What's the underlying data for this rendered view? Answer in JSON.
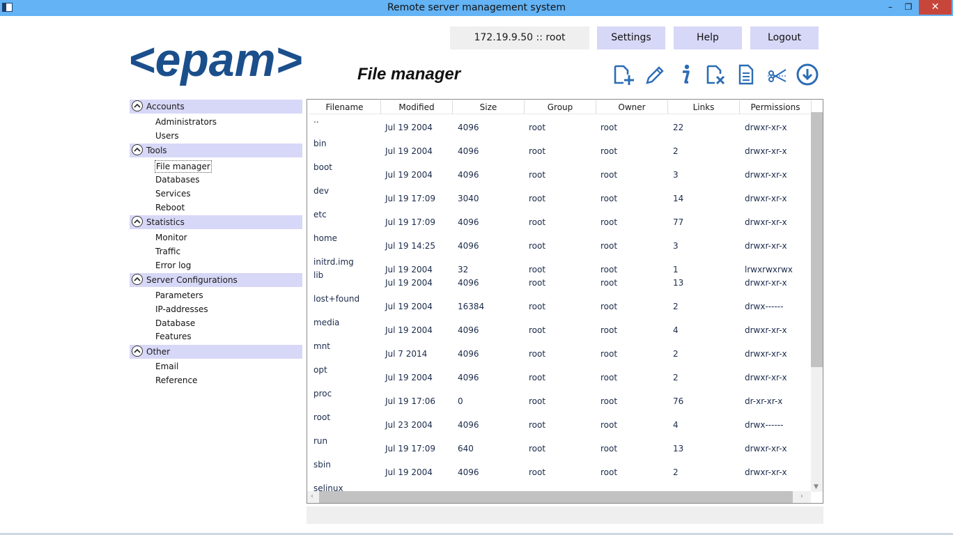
{
  "window": {
    "title": "Remote server management system",
    "minimize": "–",
    "maximize": "❐",
    "close": "✕"
  },
  "header": {
    "user_info": "172.19.9.50 :: root",
    "settings_label": "Settings",
    "help_label": "Help",
    "logout_label": "Logout",
    "page_title": "File manager",
    "logo_text": "<epam>",
    "brand_color": "#1b4f8c"
  },
  "toolbar": {
    "icons": [
      "new-file-icon",
      "edit-pencil-icon",
      "info-icon",
      "delete-file-icon",
      "document-icon",
      "cut-scissors-icon",
      "download-icon"
    ],
    "icon_color": "#2b6cb4"
  },
  "sidebar": {
    "sections": [
      {
        "label": "Accounts",
        "items": [
          "Administrators",
          "Users"
        ]
      },
      {
        "label": "Tools",
        "items": [
          "File manager",
          "Databases",
          "Services",
          "Reboot"
        ]
      },
      {
        "label": "Statistics",
        "items": [
          "Monitor",
          "Traffic",
          "Error log"
        ]
      },
      {
        "label": "Server Configurations",
        "items": [
          "Parameters",
          "IP-addresses",
          "Database",
          "Features"
        ]
      },
      {
        "label": "Other",
        "items": [
          "Email",
          "Reference"
        ]
      }
    ],
    "active_item": "File manager"
  },
  "table": {
    "columns": [
      "Filename",
      "Modified",
      "Size",
      "Group",
      "Owner",
      "Links",
      "Permissions"
    ],
    "rows": [
      {
        "name": "..",
        "modified": "Jul 19 2004",
        "size": "4096",
        "group": "root",
        "owner": "root",
        "links": "22",
        "perms": "drwxr-xr-x"
      },
      {
        "name": "bin",
        "modified": "Jul 19 2004",
        "size": "4096",
        "group": "root",
        "owner": "root",
        "links": "2",
        "perms": "drwxr-xr-x"
      },
      {
        "name": "boot",
        "modified": "Jul 19 2004",
        "size": "4096",
        "group": "root",
        "owner": "root",
        "links": "3",
        "perms": "drwxr-xr-x"
      },
      {
        "name": "dev",
        "modified": "Jul 19 17:09",
        "size": "3040",
        "group": "root",
        "owner": "root",
        "links": "14",
        "perms": "drwxr-xr-x"
      },
      {
        "name": "etc",
        "modified": "Jul 19 17:09",
        "size": "4096",
        "group": "root",
        "owner": "root",
        "links": "77",
        "perms": "drwxr-xr-x"
      },
      {
        "name": "home",
        "modified": "Jul 19 14:25",
        "size": "4096",
        "group": "root",
        "owner": "root",
        "links": "3",
        "perms": "drwxr-xr-x"
      },
      {
        "name": "initrd.img",
        "modified": "Jul 19 2004",
        "size": "32",
        "group": "root",
        "owner": "root",
        "links": "1",
        "perms": "lrwxrwxrwx"
      },
      {
        "name": "lib",
        "modified": "Jul 19 2004",
        "size": "4096",
        "group": "root",
        "owner": "root",
        "links": "13",
        "perms": "drwxr-xr-x"
      },
      {
        "name": "lost+found",
        "modified": "Jul 19 2004",
        "size": "16384",
        "group": "root",
        "owner": "root",
        "links": "2",
        "perms": "drwx------"
      },
      {
        "name": "media",
        "modified": "Jul 19 2004",
        "size": "4096",
        "group": "root",
        "owner": "root",
        "links": "4",
        "perms": "drwxr-xr-x"
      },
      {
        "name": "mnt",
        "modified": "Jul 7 2014",
        "size": "4096",
        "group": "root",
        "owner": "root",
        "links": "2",
        "perms": "drwxr-xr-x"
      },
      {
        "name": "opt",
        "modified": "Jul 19 2004",
        "size": "4096",
        "group": "root",
        "owner": "root",
        "links": "2",
        "perms": "drwxr-xr-x"
      },
      {
        "name": "proc",
        "modified": "Jul 19 17:06",
        "size": "0",
        "group": "root",
        "owner": "root",
        "links": "76",
        "perms": "dr-xr-xr-x"
      },
      {
        "name": "root",
        "modified": "Jul 23 2004",
        "size": "4096",
        "group": "root",
        "owner": "root",
        "links": "4",
        "perms": "drwx------"
      },
      {
        "name": "run",
        "modified": "Jul 19 17:09",
        "size": "640",
        "group": "root",
        "owner": "root",
        "links": "13",
        "perms": "drwxr-xr-x"
      },
      {
        "name": "sbin",
        "modified": "Jul 19 2004",
        "size": "4096",
        "group": "root",
        "owner": "root",
        "links": "2",
        "perms": "drwxr-xr-x"
      },
      {
        "name": "selinux",
        "modified": "",
        "size": "",
        "group": "",
        "owner": "",
        "links": "",
        "perms": ""
      }
    ]
  }
}
